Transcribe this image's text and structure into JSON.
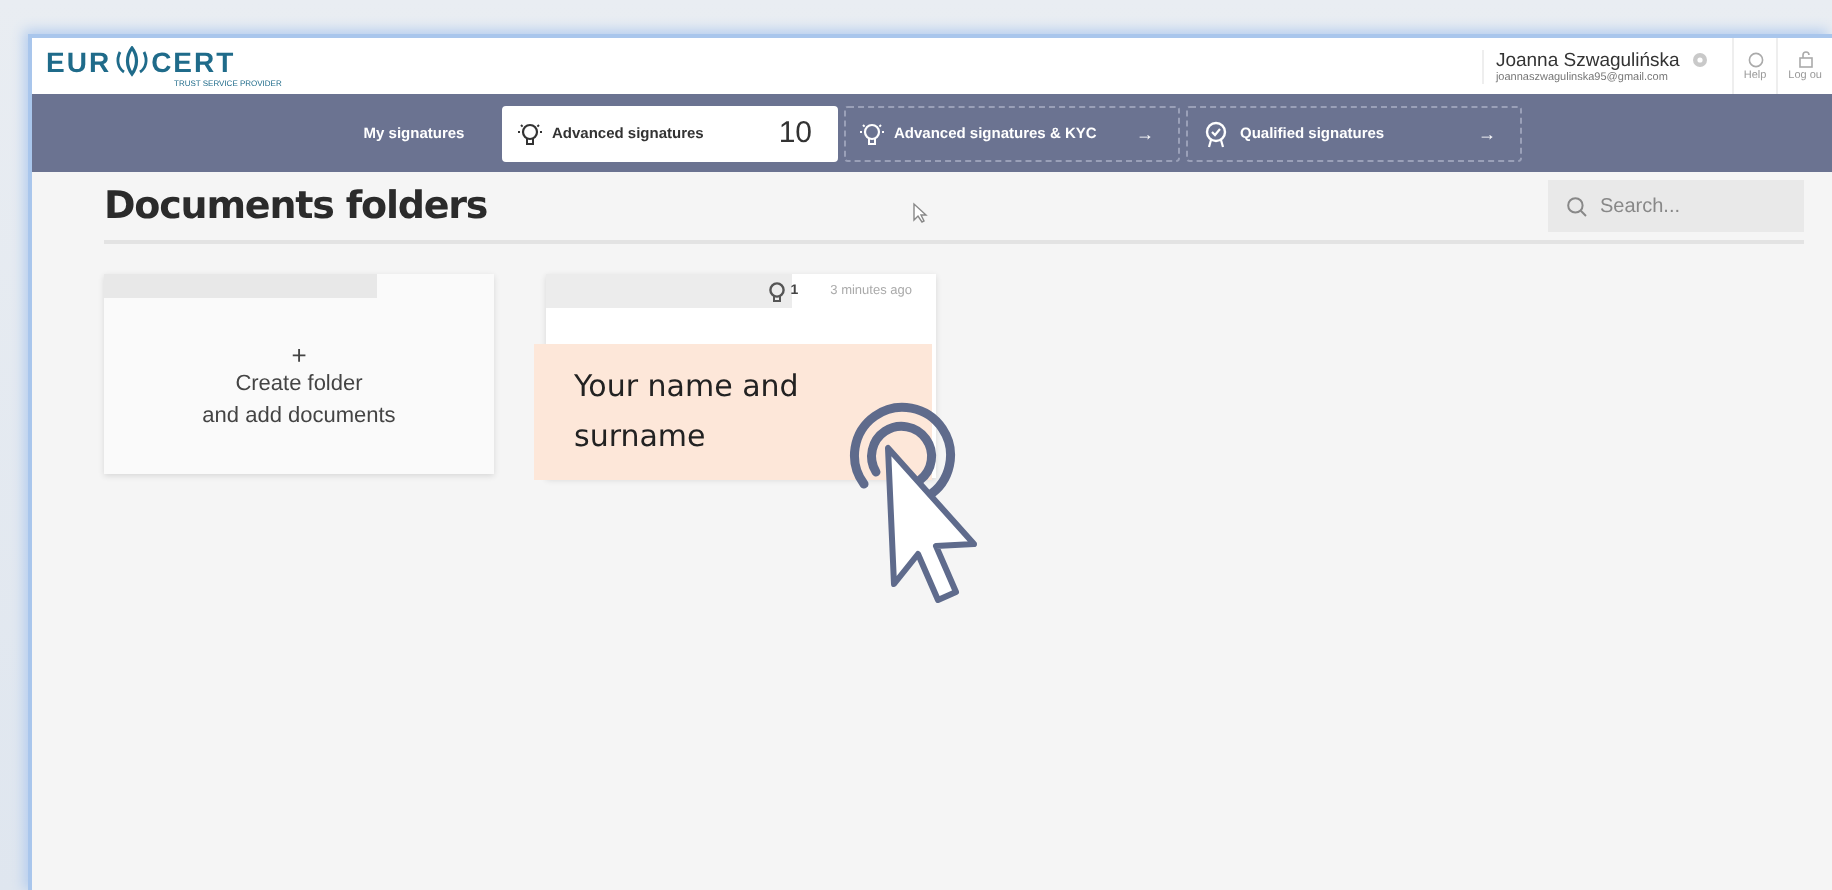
{
  "logo": {
    "left": "EUR",
    "right": "CERT",
    "tagline": "TRUST SERVICE PROVIDER"
  },
  "user": {
    "name": "Joanna Szwagulińska",
    "email": "joannaszwagulinska95@gmail.com"
  },
  "header_actions": [
    {
      "kind": "help",
      "label": "Help"
    },
    {
      "kind": "logout",
      "label": "Log ou"
    }
  ],
  "tabs": [
    {
      "kind": "plain",
      "label": "My signatures",
      "selected": false
    },
    {
      "kind": "count",
      "label": "Advanced signatures",
      "count": "10",
      "selected": true
    },
    {
      "kind": "kyc",
      "label": "Advanced signatures & KYC",
      "arrow": "→",
      "selected": false
    },
    {
      "kind": "qualified",
      "label": "Qualified signatures",
      "arrow": "→",
      "selected": false
    }
  ],
  "page_title": "Documents folders",
  "search": {
    "placeholder": "Search..."
  },
  "create_card": {
    "plus": "+",
    "label": "Create folder\nand add documents"
  },
  "folders": [
    {
      "count": "1",
      "time": "3 minutes ago"
    }
  ],
  "callout": {
    "text": "Your name and surname"
  }
}
